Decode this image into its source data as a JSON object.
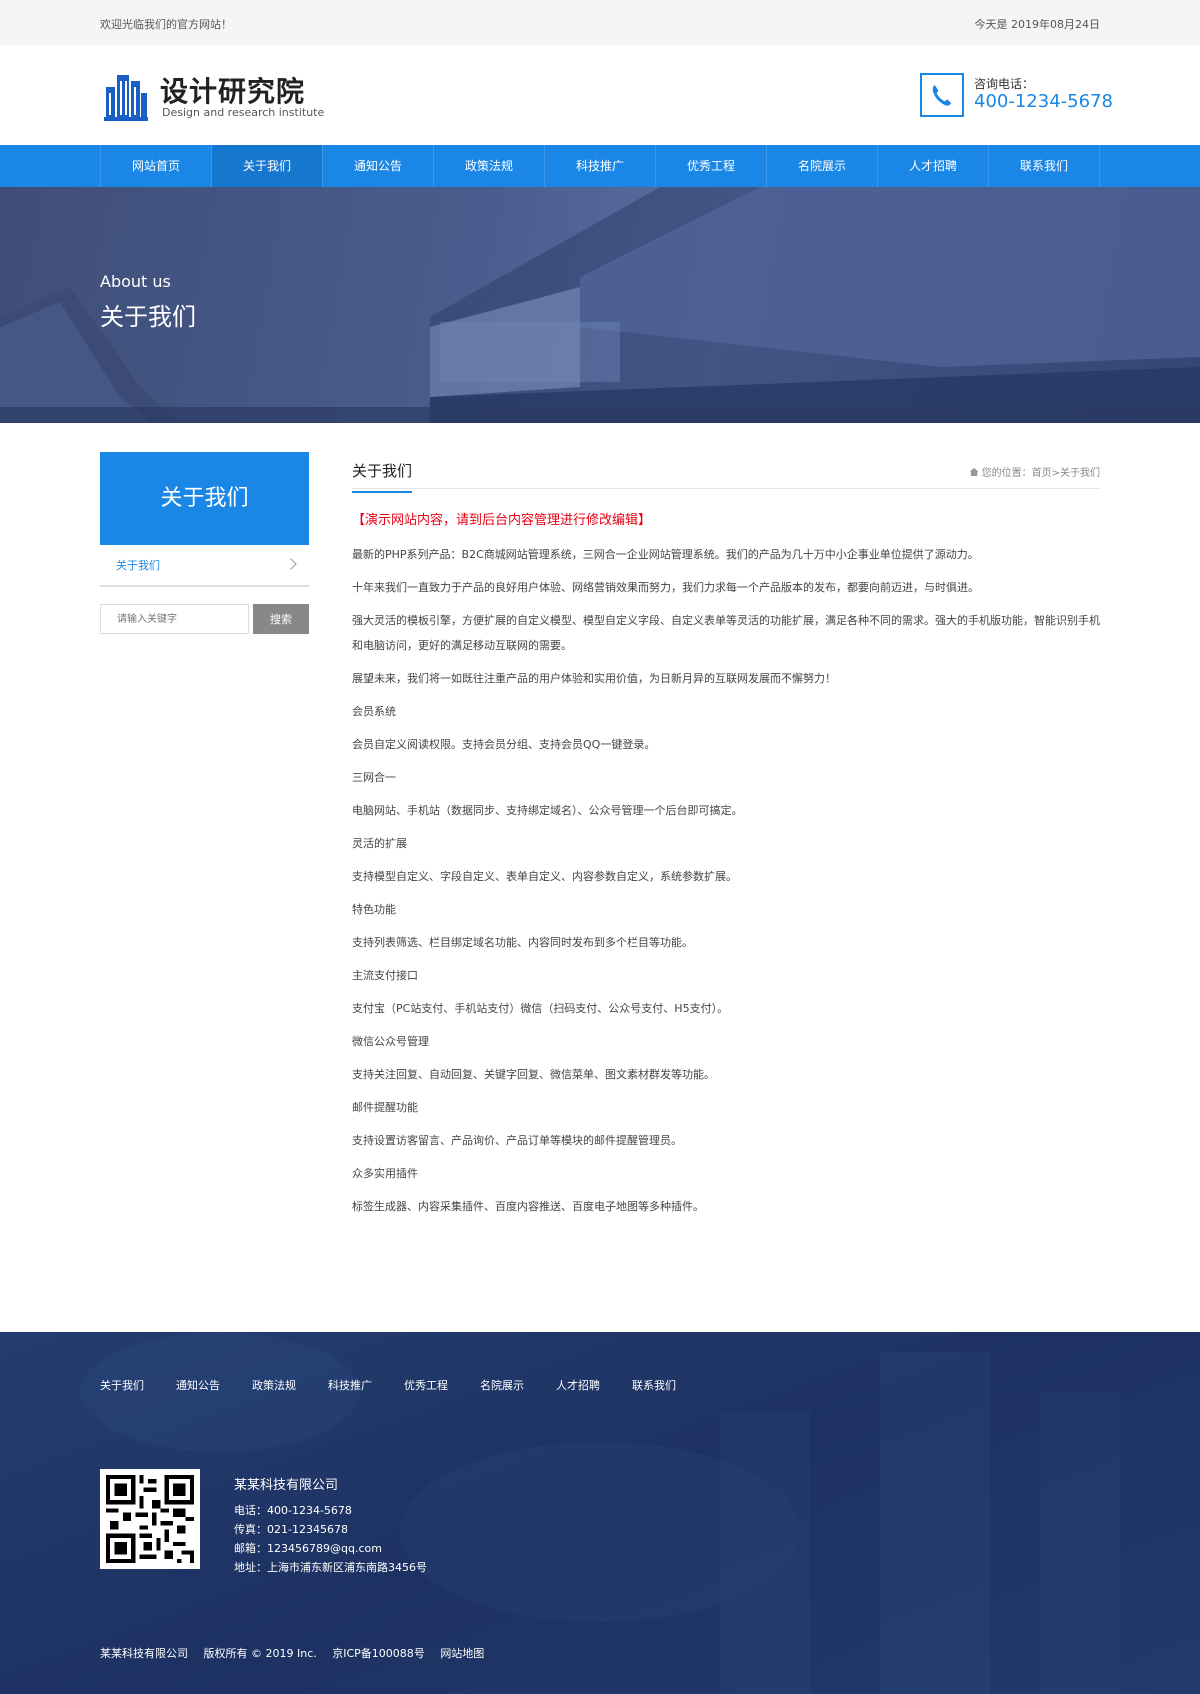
{
  "topbar": {
    "welcome": "欢迎光临我们的官方网站！",
    "date": "今天是 2019年08月24日"
  },
  "header": {
    "logo_title": "设计研究院",
    "logo_subtitle": "Design and research institute",
    "phone_label": "咨询电话：",
    "phone_number": "400-1234-5678"
  },
  "nav": {
    "items": [
      "网站首页",
      "关于我们",
      "通知公告",
      "政策法规",
      "科技推广",
      "优秀工程",
      "名院展示",
      "人才招聘",
      "联系我们"
    ],
    "active": "关于我们"
  },
  "banner": {
    "en": "About us",
    "cn": "关于我们"
  },
  "sidebar": {
    "title": "关于我们",
    "items": [
      "关于我们"
    ],
    "search_placeholder": "请输入关键字",
    "search_button": "搜索"
  },
  "main": {
    "title": "关于我们",
    "breadcrumb": {
      "prefix": "您的位置：",
      "home": "首页",
      "sep": ">",
      "current": "关于我们"
    },
    "notice": "【演示网站内容，请到后台内容管理进行修改编辑】",
    "paragraphs": [
      "最新的PHP系列产品：B2C商城网站管理系统，三网合一企业网站管理系统。我们的产品为几十万中小企事业单位提供了源动力。",
      "十年来我们一直致力于产品的良好用户体验、网络营销效果而努力，我们力求每一个产品版本的发布，都要向前迈进，与时俱进。",
      "强大灵活的模板引擎，方便扩展的自定义模型、模型自定义字段、自定义表单等灵活的功能扩展，满足各种不同的需求。强大的手机版功能，智能识别手机和电脑访问，更好的满足移动互联网的需要。",
      "展望未来，我们将一如既往注重产品的用户体验和实用价值，为日新月异的互联网发展而不懈努力！",
      "会员系统",
      "会员自定义阅读权限。支持会员分组、支持会员QQ一键登录。",
      "三网合一",
      "电脑网站、手机站（数据同步、支持绑定域名）、公众号管理一个后台即可搞定。",
      "灵活的扩展",
      "支持模型自定义、字段自定义、表单自定义、内容参数自定义，系统参数扩展。",
      "特色功能",
      "支持列表筛选、栏目绑定域名功能、内容同时发布到多个栏目等功能。",
      "主流支付接口",
      "支付宝（PC站支付、手机站支付）微信（扫码支付、公众号支付、H5支付）。",
      "微信公众号管理",
      "支持关注回复、自动回复、关键字回复、微信菜单、图文素材群发等功能。",
      "邮件提醒功能",
      "支持设置访客留言、产品询价、产品订单等模块的邮件提醒管理员。",
      "众多实用插件",
      "标签生成器、内容采集插件、百度内容推送、百度电子地图等多种插件。"
    ]
  },
  "footer": {
    "links": [
      "关于我们",
      "通知公告",
      "政策法规",
      "科技推广",
      "优秀工程",
      "名院展示",
      "人才招聘",
      "联系我们"
    ],
    "company": "某某科技有限公司",
    "tel": "电话：400-1234-5678",
    "fax": "传真：021-12345678",
    "email": "邮箱：123456789@qq.com",
    "address": "地址：上海市浦东新区浦东南路3456号",
    "copyright": [
      "某某科技有限公司",
      "版权所有 © 2019 Inc.",
      "京ICP备100088号",
      "网站地图"
    ]
  },
  "colors": {
    "primary": "#1a87e6",
    "nav_active": "#1677cf",
    "notice": "#e60012",
    "footer_bg": "#1d3263"
  }
}
